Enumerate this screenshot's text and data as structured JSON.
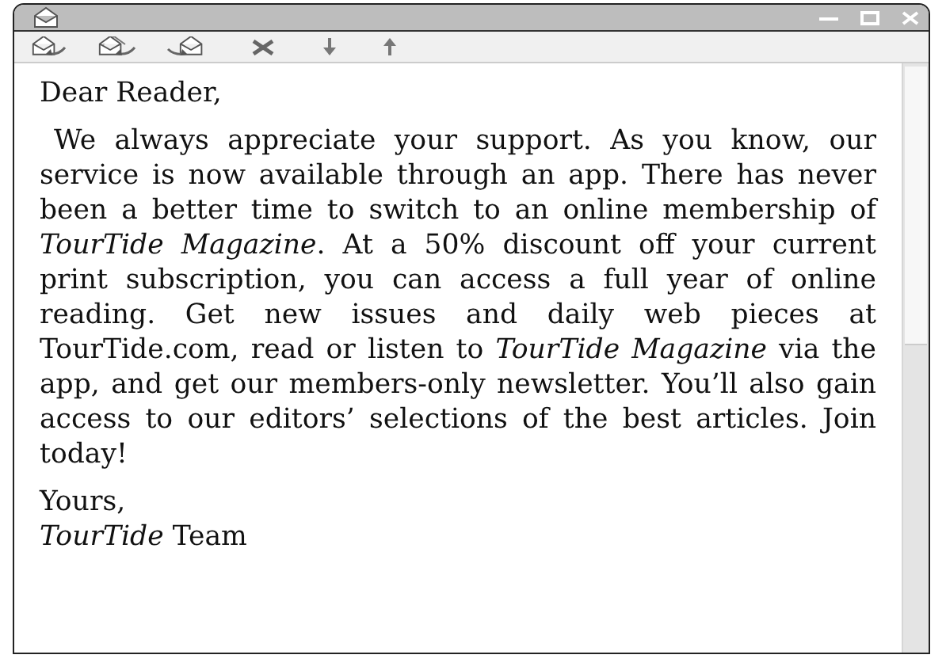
{
  "letter": {
    "greeting": "Dear Reader,",
    "body": "We always appreciate your support. As you know, our service is now available through an app. There has never been a better time to switch to an online membership of *TourTide Magazine*. At a 50% discount off your current print subscription, you can access a full year of online reading. Get new issues and daily web pieces at TourTide.com, read or listen to *TourTide Magazine* via the app, and get our members-only newsletter. You’ll also gain access to our editors’ selections of the best articles. Join today!",
    "closing": "Yours,",
    "signature": "*TourTide* Team"
  }
}
